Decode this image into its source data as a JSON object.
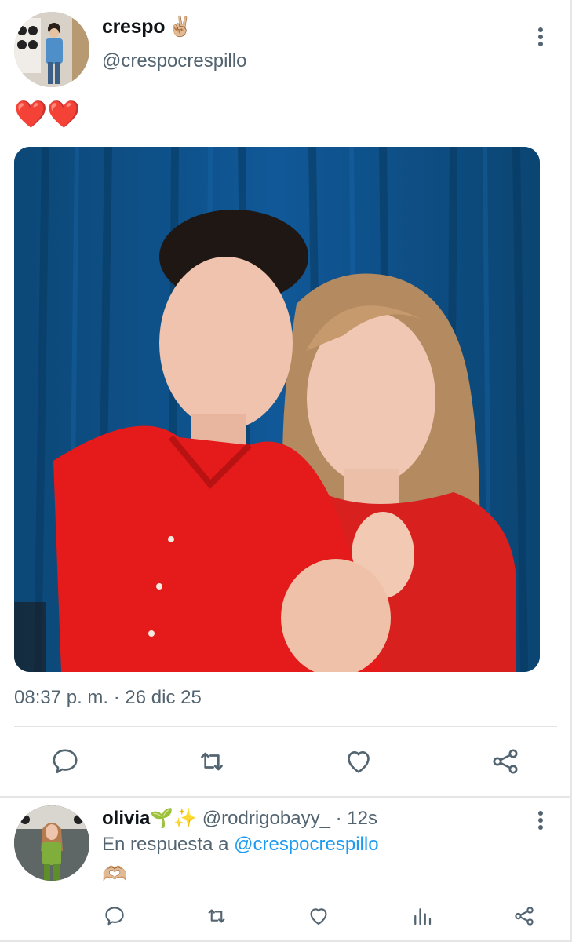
{
  "tweet": {
    "author": {
      "name": "crespo",
      "name_emoji": "✌🏼",
      "handle": "@crespocrespillo"
    },
    "text": "❤️❤️",
    "timestamp": "08:37 p. m. · 26 dic 25",
    "icons": {
      "reply": "reply-icon",
      "retweet": "retweet-icon",
      "like": "heart-icon",
      "share": "share-icon",
      "more": "more-vertical-icon"
    }
  },
  "reply": {
    "name": "olivia🌱✨",
    "handle": "@rodrigobayy_",
    "separator": "·",
    "time": "12s",
    "in_reply_prefix": "En respuesta a",
    "in_reply_handle": "@crespocrespillo",
    "text": "🫶🏼",
    "icons": {
      "reply": "reply-icon",
      "retweet": "retweet-icon",
      "like": "heart-icon",
      "views": "views-icon",
      "share": "share-icon"
    }
  },
  "colors": {
    "text_primary": "#0f1419",
    "text_secondary": "#536471",
    "link": "#1d9bf0",
    "icon": "#536471",
    "divider": "#e3e3e3",
    "photo_curtain": "#0b4a7c",
    "photo_shirt": "#e51b1b"
  }
}
